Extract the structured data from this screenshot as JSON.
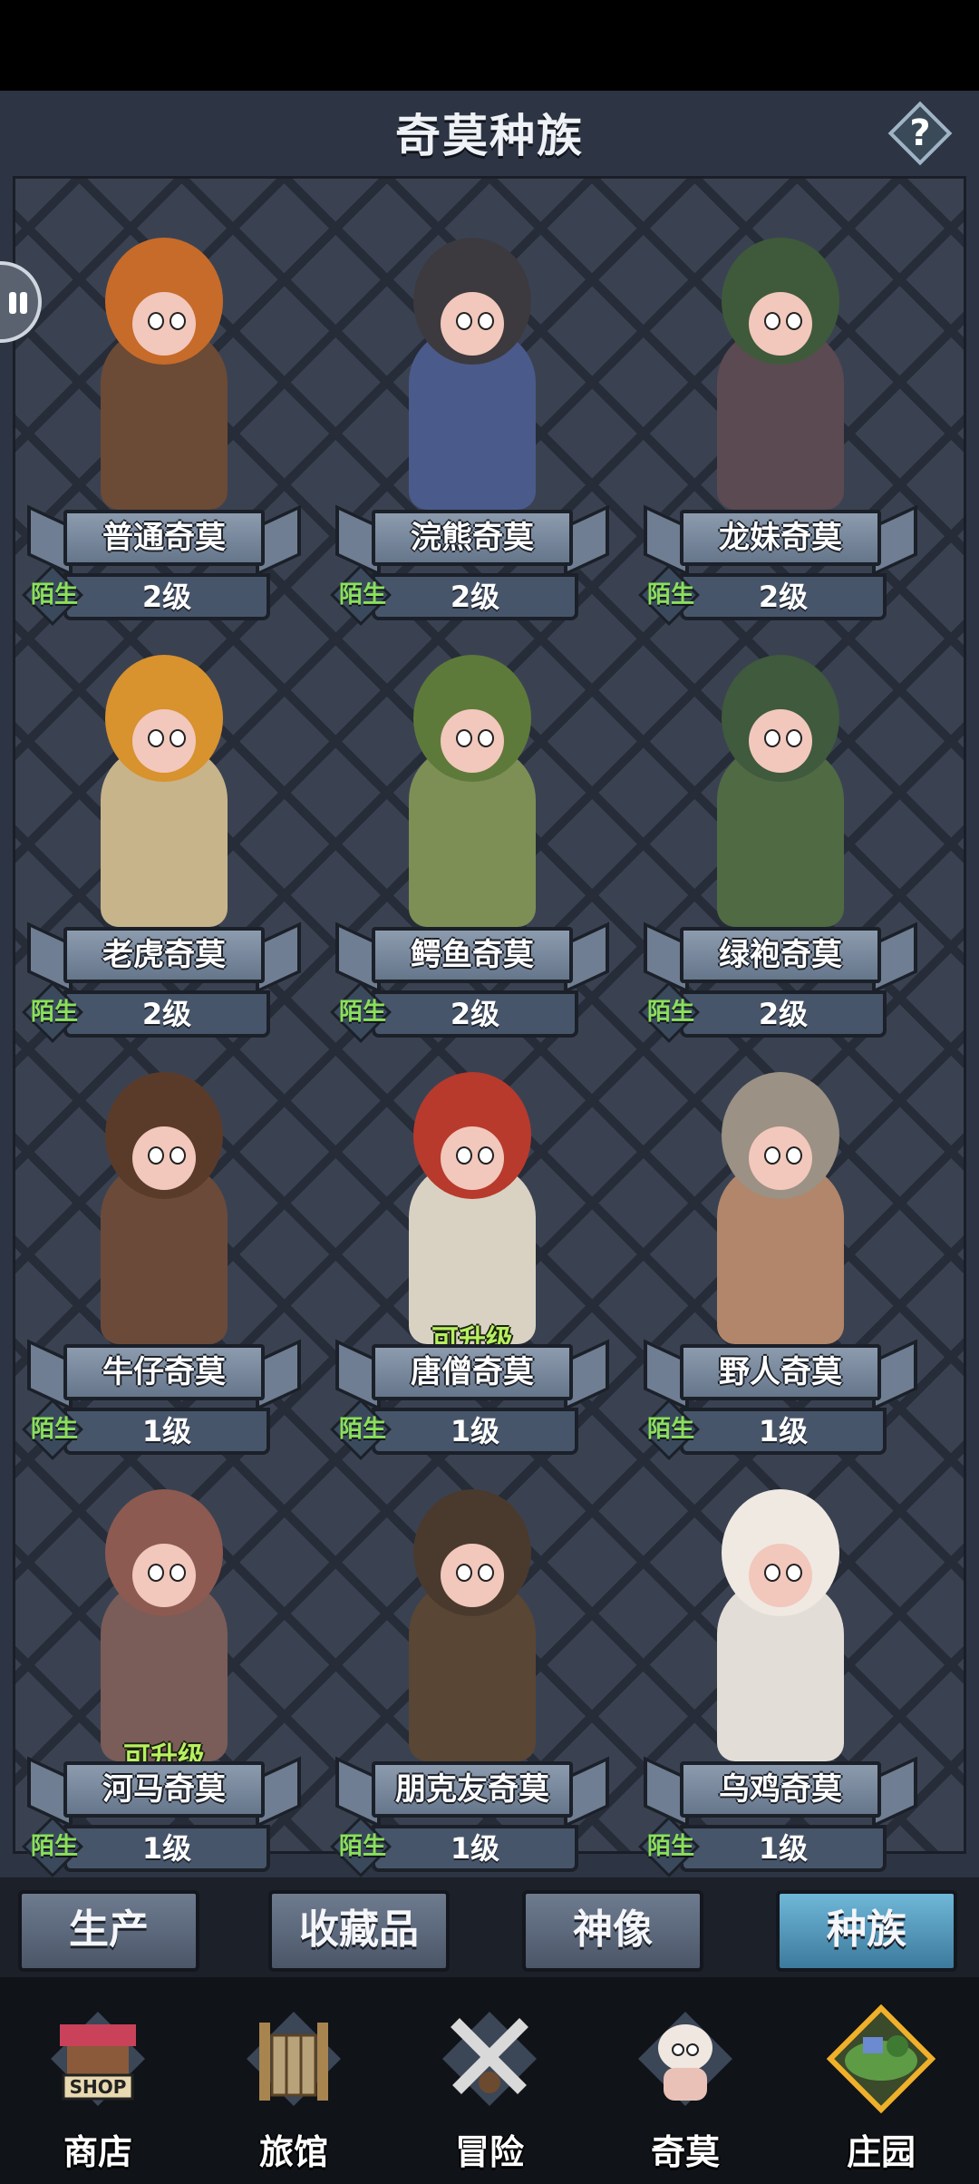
{
  "header": {
    "title": "奇莫种族",
    "help": "?"
  },
  "cards": [
    {
      "name": "普通奇莫",
      "tag": "陌生",
      "level": "2级",
      "upgrade": ""
    },
    {
      "name": "浣熊奇莫",
      "tag": "陌生",
      "level": "2级",
      "upgrade": ""
    },
    {
      "name": "龙妹奇莫",
      "tag": "陌生",
      "level": "2级",
      "upgrade": ""
    },
    {
      "name": "老虎奇莫",
      "tag": "陌生",
      "level": "2级",
      "upgrade": ""
    },
    {
      "name": "鳄鱼奇莫",
      "tag": "陌生",
      "level": "2级",
      "upgrade": ""
    },
    {
      "name": "绿袍奇莫",
      "tag": "陌生",
      "level": "2级",
      "upgrade": ""
    },
    {
      "name": "牛仔奇莫",
      "tag": "陌生",
      "level": "1级",
      "upgrade": ""
    },
    {
      "name": "唐僧奇莫",
      "tag": "陌生",
      "level": "1级",
      "upgrade": "可升级"
    },
    {
      "name": "野人奇莫",
      "tag": "陌生",
      "level": "1级",
      "upgrade": ""
    },
    {
      "name": "河马奇莫",
      "tag": "陌生",
      "level": "1级",
      "upgrade": "可升级"
    },
    {
      "name": "朋克友奇莫",
      "tag": "陌生",
      "level": "1级",
      "upgrade": ""
    },
    {
      "name": "乌鸡奇莫",
      "tag": "陌生",
      "level": "1级",
      "upgrade": ""
    }
  ],
  "tabs": [
    {
      "label": "生产",
      "active": false
    },
    {
      "label": "收藏品",
      "active": false
    },
    {
      "label": "神像",
      "active": false
    },
    {
      "label": "种族",
      "active": true
    }
  ],
  "nav": [
    {
      "label": "商店",
      "icon": "shop-icon",
      "badge": "SHOP"
    },
    {
      "label": "旅馆",
      "icon": "inn-gate-icon"
    },
    {
      "label": "冒险",
      "icon": "crossed-swords-icon"
    },
    {
      "label": "奇莫",
      "icon": "qimo-character-icon"
    },
    {
      "label": "庄园",
      "icon": "manor-island-icon"
    }
  ],
  "colors": {
    "accent_active_tab": "#4f9bc0",
    "tag_green": "#8be05a",
    "upgrade_green": "#b8f060",
    "panel": "#2d3443"
  }
}
